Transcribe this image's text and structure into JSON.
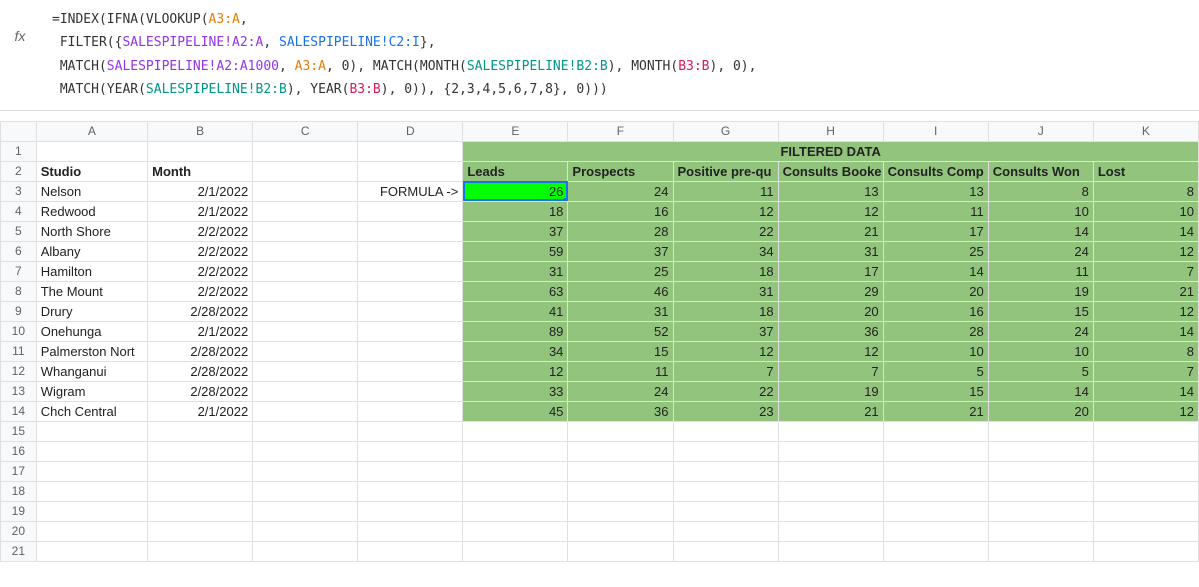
{
  "formula": {
    "lines": [
      "=INDEX(IFNA(VLOOKUP(A3:A,",
      " FILTER({SALESPIPELINE!A2:A, SALESPIPELINE!C2:I},",
      " MATCH(SALESPIPELINE!A2:A1000, A3:A, 0), MATCH(MONTH(SALESPIPELINE!B2:B), MONTH(B3:B), 0),",
      " MATCH(YEAR(SALESPIPELINE!B2:B), YEAR(B3:B), 0)), {2,3,4,5,6,7,8}, 0)))"
    ]
  },
  "headers": {
    "filtered_title": "FILTERED DATA",
    "studio": "Studio",
    "month": "Month",
    "formula_arrow": "FORMULA ->",
    "cols": [
      "Leads",
      "Prospects",
      "Positive pre-qu",
      "Consults Booke",
      "Consults Comp",
      "Consults Won",
      "Lost"
    ]
  },
  "columns": [
    "A",
    "B",
    "C",
    "D",
    "E",
    "F",
    "G",
    "H",
    "I",
    "J",
    "K"
  ],
  "row_numbers": [
    "1",
    "2",
    "3",
    "4",
    "5",
    "6",
    "7",
    "8",
    "9",
    "10",
    "11",
    "12",
    "13",
    "14",
    "15",
    "16",
    "17",
    "18",
    "19",
    "20",
    "21"
  ],
  "rows": [
    {
      "studio": "Nelson",
      "month": "2/1/2022",
      "data": [
        26,
        24,
        11,
        13,
        13,
        8,
        8
      ]
    },
    {
      "studio": "Redwood",
      "month": "2/1/2022",
      "data": [
        18,
        16,
        12,
        12,
        11,
        10,
        10
      ]
    },
    {
      "studio": "North Shore",
      "month": "2/2/2022",
      "data": [
        37,
        28,
        22,
        21,
        17,
        14,
        14
      ]
    },
    {
      "studio": "Albany",
      "month": "2/2/2022",
      "data": [
        59,
        37,
        34,
        31,
        25,
        24,
        12
      ]
    },
    {
      "studio": "Hamilton",
      "month": "2/2/2022",
      "data": [
        31,
        25,
        18,
        17,
        14,
        11,
        7
      ]
    },
    {
      "studio": "The Mount",
      "month": "2/2/2022",
      "data": [
        63,
        46,
        31,
        29,
        20,
        19,
        21
      ]
    },
    {
      "studio": "Drury",
      "month": "2/28/2022",
      "data": [
        41,
        31,
        18,
        20,
        16,
        15,
        12
      ]
    },
    {
      "studio": "Onehunga",
      "month": "2/1/2022",
      "data": [
        89,
        52,
        37,
        36,
        28,
        24,
        14
      ]
    },
    {
      "studio": "Palmerston Nort",
      "month": "2/28/2022",
      "data": [
        34,
        15,
        12,
        12,
        10,
        10,
        8
      ]
    },
    {
      "studio": "Whanganui",
      "month": "2/28/2022",
      "data": [
        12,
        11,
        7,
        7,
        5,
        5,
        7
      ]
    },
    {
      "studio": "Wigram",
      "month": "2/28/2022",
      "data": [
        33,
        24,
        22,
        19,
        15,
        14,
        14
      ]
    },
    {
      "studio": "Chch Central",
      "month": "2/1/2022",
      "data": [
        45,
        36,
        23,
        21,
        21,
        20,
        12
      ]
    }
  ]
}
